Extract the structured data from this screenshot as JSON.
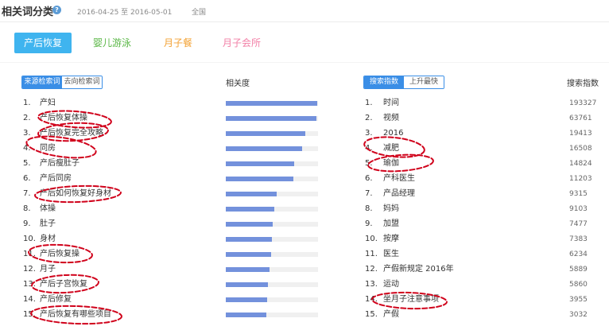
{
  "header": {
    "title": "相关词分类",
    "help_icon": "question-circle-icon",
    "date_range": "2016-04-25 至 2016-05-01",
    "region": "全国"
  },
  "colors": {
    "tab_active_bg": "#3fb4ef",
    "toggle_active": "#3a8ee6",
    "bar_fill": "#7391dc",
    "bar_track": "#f0f0f0",
    "annotation": "#d0021b",
    "help_icon": "#5b9bd5"
  },
  "tabs": [
    {
      "label": "产后恢复",
      "active": true,
      "color": "#ffffff"
    },
    {
      "label": "婴儿游泳",
      "active": false,
      "color": "#5ab746"
    },
    {
      "label": "月子餐",
      "active": false,
      "color": "#f3a233"
    },
    {
      "label": "月子会所",
      "active": false,
      "color": "#f27fa6"
    }
  ],
  "left_panel": {
    "toggle": [
      {
        "label": "来源检索词",
        "active": true
      },
      {
        "label": "去向检索词",
        "active": false
      }
    ],
    "column_header": "相关度",
    "items": [
      {
        "rank": "1.",
        "word": "产妇",
        "relevance": 0.99
      },
      {
        "rank": "2.",
        "word": "产后恢复体操",
        "relevance": 0.98
      },
      {
        "rank": "3.",
        "word": "产后恢复完全攻略",
        "relevance": 0.86
      },
      {
        "rank": "4.",
        "word": "同房",
        "relevance": 0.83
      },
      {
        "rank": "5.",
        "word": "产后瘦肚子",
        "relevance": 0.74
      },
      {
        "rank": "6.",
        "word": "产后同房",
        "relevance": 0.73
      },
      {
        "rank": "7.",
        "word": "产后如何恢复好身材",
        "relevance": 0.55
      },
      {
        "rank": "8.",
        "word": "体操",
        "relevance": 0.53
      },
      {
        "rank": "9.",
        "word": "肚子",
        "relevance": 0.51
      },
      {
        "rank": "10.",
        "word": "身材",
        "relevance": 0.5
      },
      {
        "rank": "11.",
        "word": "产后恢复操",
        "relevance": 0.49
      },
      {
        "rank": "12.",
        "word": "月子",
        "relevance": 0.47
      },
      {
        "rank": "13.",
        "word": "产后子宫恢复",
        "relevance": 0.46
      },
      {
        "rank": "14.",
        "word": "产后修复",
        "relevance": 0.45
      },
      {
        "rank": "15.",
        "word": "产后恢复有哪些项目",
        "relevance": 0.44
      }
    ]
  },
  "right_panel": {
    "toggle": [
      {
        "label": "搜索指数",
        "active": true
      },
      {
        "label": "上升最快",
        "active": false
      }
    ],
    "column_header": "搜索指数",
    "items": [
      {
        "rank": "1.",
        "word": "时间",
        "value": "193327"
      },
      {
        "rank": "2.",
        "word": "视频",
        "value": "63761"
      },
      {
        "rank": "3.",
        "word": "2016",
        "value": "19413"
      },
      {
        "rank": "4.",
        "word": "减肥",
        "value": "16508"
      },
      {
        "rank": "5.",
        "word": "瑜伽",
        "value": "14824"
      },
      {
        "rank": "6.",
        "word": "产科医生",
        "value": "11203"
      },
      {
        "rank": "7.",
        "word": "产品经理",
        "value": "9315"
      },
      {
        "rank": "8.",
        "word": "妈妈",
        "value": "9103"
      },
      {
        "rank": "9.",
        "word": "加盟",
        "value": "7477"
      },
      {
        "rank": "10.",
        "word": "按摩",
        "value": "7383"
      },
      {
        "rank": "11.",
        "word": "医生",
        "value": "6234"
      },
      {
        "rank": "12.",
        "word": "产假新规定 2016年",
        "value": "5889"
      },
      {
        "rank": "13.",
        "word": "运动",
        "value": "5860"
      },
      {
        "rank": "14.",
        "word": "坐月子注意事项",
        "value": "3955"
      },
      {
        "rank": "15.",
        "word": "产假",
        "value": "3032"
      }
    ]
  }
}
